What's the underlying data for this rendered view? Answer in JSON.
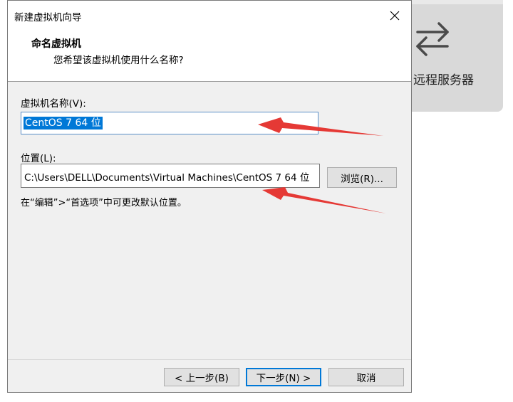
{
  "background_app": {
    "remote_server_label": "远程服务器",
    "icon": "swap-arrows-icon"
  },
  "dialog": {
    "title": "新建虚拟机向导",
    "close_icon": "close-icon",
    "header_title": "命名虚拟机",
    "header_subtitle": "您希望该虚拟机使用什么名称?",
    "name_label": "虚拟机名称(V):",
    "name_value": "CentOS 7 64 位",
    "location_label": "位置(L):",
    "location_value": "C:\\Users\\DELL\\Documents\\Virtual Machines\\CentOS 7 64 位",
    "browse_label": "浏览(R)...",
    "hint": "在“编辑”>“首选项”中可更改默认位置。",
    "back_label": "< 上一步(B)",
    "next_label": "下一步(N) >",
    "cancel_label": "取消"
  },
  "annotations": {
    "arrow_color": "#e53935"
  }
}
